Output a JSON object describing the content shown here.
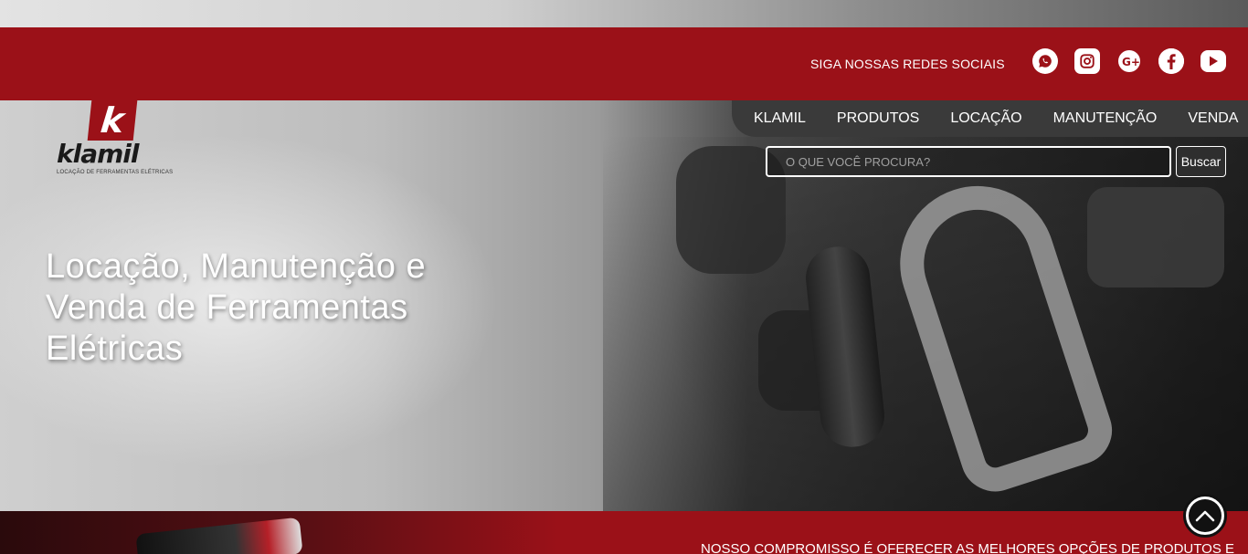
{
  "social": {
    "label": "SIGA NOSSAS REDES SOCIAIS",
    "icons": [
      "whatsapp-icon",
      "instagram-icon",
      "google-plus-icon",
      "facebook-icon",
      "youtube-icon"
    ]
  },
  "logo": {
    "mark": "k",
    "word": "klamil",
    "tagline": "LOCAÇÃO DE FERRAMENTAS ELÉTRICAS"
  },
  "nav": {
    "items": [
      "KLAMIL",
      "PRODUTOS",
      "LOCAÇÃO",
      "MANUTENÇÃO",
      "VENDA"
    ]
  },
  "search": {
    "placeholder": "O QUE VOCÊ PROCURA?",
    "button_label": "Buscar"
  },
  "hero": {
    "headline": "Locação, Manutenção e Venda de Ferramentas Elétricas"
  },
  "bottom": {
    "text": "NOSSO COMPROMISSO É OFERECER AS MELHORES OPÇÕES DE PRODUTOS E"
  },
  "colors": {
    "brand_red": "#9b1118",
    "nav_bg": "#3a3a3a"
  }
}
